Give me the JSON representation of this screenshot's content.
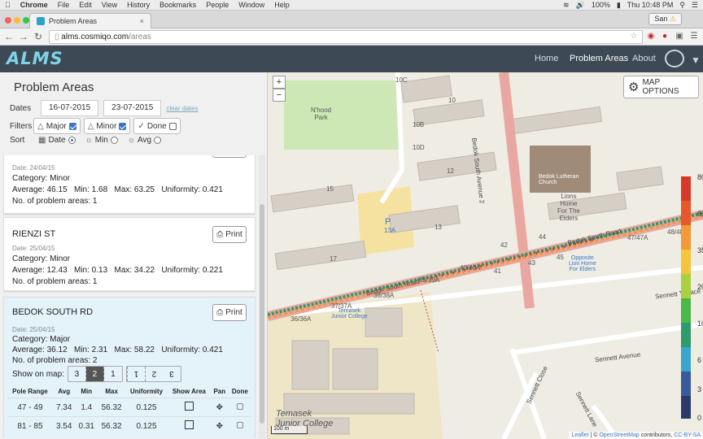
{
  "os": {
    "app": "Chrome",
    "menus": [
      "File",
      "Edit",
      "View",
      "History",
      "Bookmarks",
      "People",
      "Window",
      "Help"
    ],
    "battery": "100%",
    "clock": "Thu 10:48 PM"
  },
  "browser": {
    "tab_title": "Problem Areas",
    "user": "San",
    "url_host": "alms.cosmiqo.com",
    "url_path": "/areas"
  },
  "app": {
    "logo": "ALMS",
    "nav": {
      "home": "Home",
      "problem_areas": "Problem Areas",
      "about": "About"
    }
  },
  "panel": {
    "title": "Problem Areas",
    "dates_label": "Dates",
    "date_from": "16-07-2015",
    "date_to": "23-07-2015",
    "clear_dates": "clear dates",
    "filters_label": "Filters",
    "filters": [
      {
        "label": "Major",
        "checked": true
      },
      {
        "label": "Minor",
        "checked": true
      },
      {
        "label": "Done",
        "checked": false
      }
    ],
    "sort_label": "Sort",
    "sorts": [
      {
        "label": "Date",
        "selected": true
      },
      {
        "label": "Min",
        "selected": false
      },
      {
        "label": "Avg",
        "selected": false
      }
    ]
  },
  "cards": [
    {
      "name": "",
      "date": "Date: 24/04/15",
      "category": "Category: Minor",
      "average": "Average: 46.15",
      "min": "Min: 1.68",
      "max": "Max: 63.25",
      "uniformity": "Uniformity: 0.421",
      "count": "No. of problem areas: 1"
    },
    {
      "name": "RIENZI ST",
      "date": "Date: 25/04/15",
      "category": "Category: Minor",
      "average": "Average: 12.43",
      "min": "Min: 0.13",
      "max": "Max: 34.22",
      "uniformity": "Uniformity: 0.221",
      "count": "No. of problem areas: 1",
      "print": "Print"
    },
    {
      "name": "BEDOK SOUTH RD",
      "date": "Date: 25/04/15",
      "category": "Category: Major",
      "average": "Average: 36.12",
      "min": "Min: 2.31",
      "max": "Max: 58.22",
      "uniformity": "Uniformity: 0.421",
      "count": "No. of problem areas: 2",
      "print": "Print",
      "show_on_map": "Show on map:",
      "map_buttons": [
        "3",
        "2",
        "1",
        "1",
        "2",
        "3"
      ],
      "columns": [
        "Pole Range",
        "Avg",
        "Min",
        "Max",
        "Uniformity",
        "Show Area",
        "Pan",
        "Done"
      ],
      "rows": [
        {
          "range": "47 - 49",
          "avg": "7.34",
          "min": "1.4",
          "max": "56.32",
          "uniformity": "0.125"
        },
        {
          "range": "81 - 85",
          "avg": "3.54",
          "min": "0.31",
          "max": "56.32",
          "uniformity": "0.125"
        }
      ]
    }
  ],
  "map": {
    "options": "MAP OPTIONS",
    "zoom_in": "+",
    "zoom_out": "−",
    "labels": {
      "park": "N'hood\nPark",
      "church": "Bedok Lutheran\nChurch",
      "lions": "Lions\nHome\nFor The\nElders",
      "opp_lions": "Opposite\nLion Home\nFor Elders",
      "temasek_jc": "Temasek\nJunior College",
      "temasek_big": "Temasek\nJunior College",
      "bedok_south_rd": "Bedok South Road",
      "bedok_south_rd2": "Bedok South Road",
      "bedok_south_ave2": "Bedok South Avenue 2",
      "sennett_terrace": "Sennett Terrace",
      "sennett_avenue": "Sennett Avenue",
      "sennett_close": "Sennett Close",
      "sennett_lane": "Sennett Lane",
      "parking": "P"
    },
    "block_numbers": [
      "10C",
      "10",
      "10B",
      "10D",
      "12",
      "13",
      "15",
      "17",
      "13A",
      "40/40A",
      "38/38A",
      "39/39A",
      "37/37A",
      "36/36A",
      "47/47A",
      "48/48A",
      "42",
      "43",
      "44",
      "45",
      "41"
    ],
    "legend_ticks": [
      "80",
      "65",
      "35",
      "20",
      "10",
      "6",
      "3",
      "0"
    ],
    "legend_colors": [
      "#d83a2a",
      "#e8562c",
      "#f09a3a",
      "#f2c53c",
      "#a8d040",
      "#4cb84a",
      "#2f9a6a",
      "#3aa6cc",
      "#3a5a9a",
      "#2b3a66"
    ],
    "scale": "100 m",
    "attribution_leaflet": "Leaflet",
    "attribution_osm": "OpenStreetMap",
    "attribution_rest": "contributors,",
    "attribution_license": "CC-BY-SA"
  }
}
